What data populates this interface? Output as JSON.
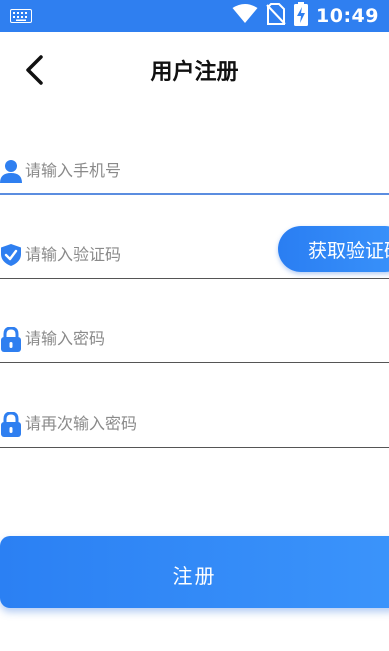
{
  "status_bar": {
    "time": "10:49",
    "icons": [
      "keyboard-icon",
      "wifi-icon",
      "no-sim-icon",
      "battery-charging-icon"
    ]
  },
  "header": {
    "title": "用户注册",
    "back_icon": "chevron-left-icon"
  },
  "form": {
    "phone": {
      "placeholder": "请输入手机号",
      "value": "",
      "icon": "user-icon"
    },
    "code": {
      "placeholder": "请输入验证码",
      "value": "",
      "icon": "shield-check-icon"
    },
    "get_code_label": "获取验证码",
    "password": {
      "placeholder": "请输入密码",
      "value": "",
      "icon": "lock-icon"
    },
    "confirm_password": {
      "placeholder": "请再次输入密码",
      "value": "",
      "icon": "lock-icon"
    }
  },
  "register_button": {
    "label": "注册"
  },
  "colors": {
    "accent": "#2f7ff0",
    "active_underline": "#5b8de0",
    "placeholder": "#8a8a8a"
  }
}
